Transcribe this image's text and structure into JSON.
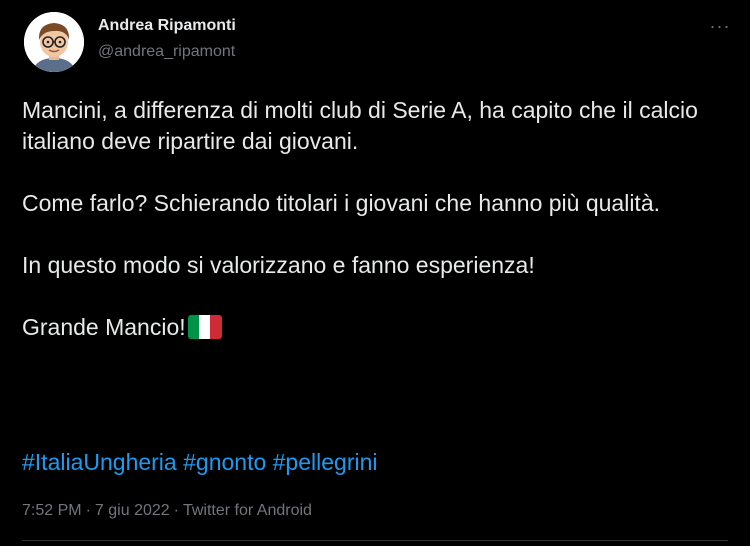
{
  "author": {
    "name": "Andrea Ripamonti",
    "handle": "@andrea_ripamont"
  },
  "tweet": {
    "paragraphs": [
      "Mancini, a differenza di molti club di Serie A, ha capito che il calcio italiano deve ripartire dai giovani.",
      "Come farlo? Schierando titolari i giovani che hanno più qualità.",
      "In questo modo si valorizzano e fanno esperienza!",
      "Grande Mancio!"
    ],
    "flag_icon": "italy-flag-emoji",
    "hashtags": [
      "#ItaliaUngheria",
      "#gnonto",
      "#pellegrini"
    ]
  },
  "meta": {
    "time": "7:52 PM",
    "date": "7 giu 2022",
    "source": "Twitter for Android",
    "separator": "·"
  },
  "icons": {
    "more": "more-options-icon"
  },
  "colors": {
    "background": "#000000",
    "text": "#e7e9ea",
    "secondary": "#71767b",
    "link": "#1d9bf0",
    "flag_green": "#009246",
    "flag_white": "#ffffff",
    "flag_red": "#ce2b37"
  }
}
